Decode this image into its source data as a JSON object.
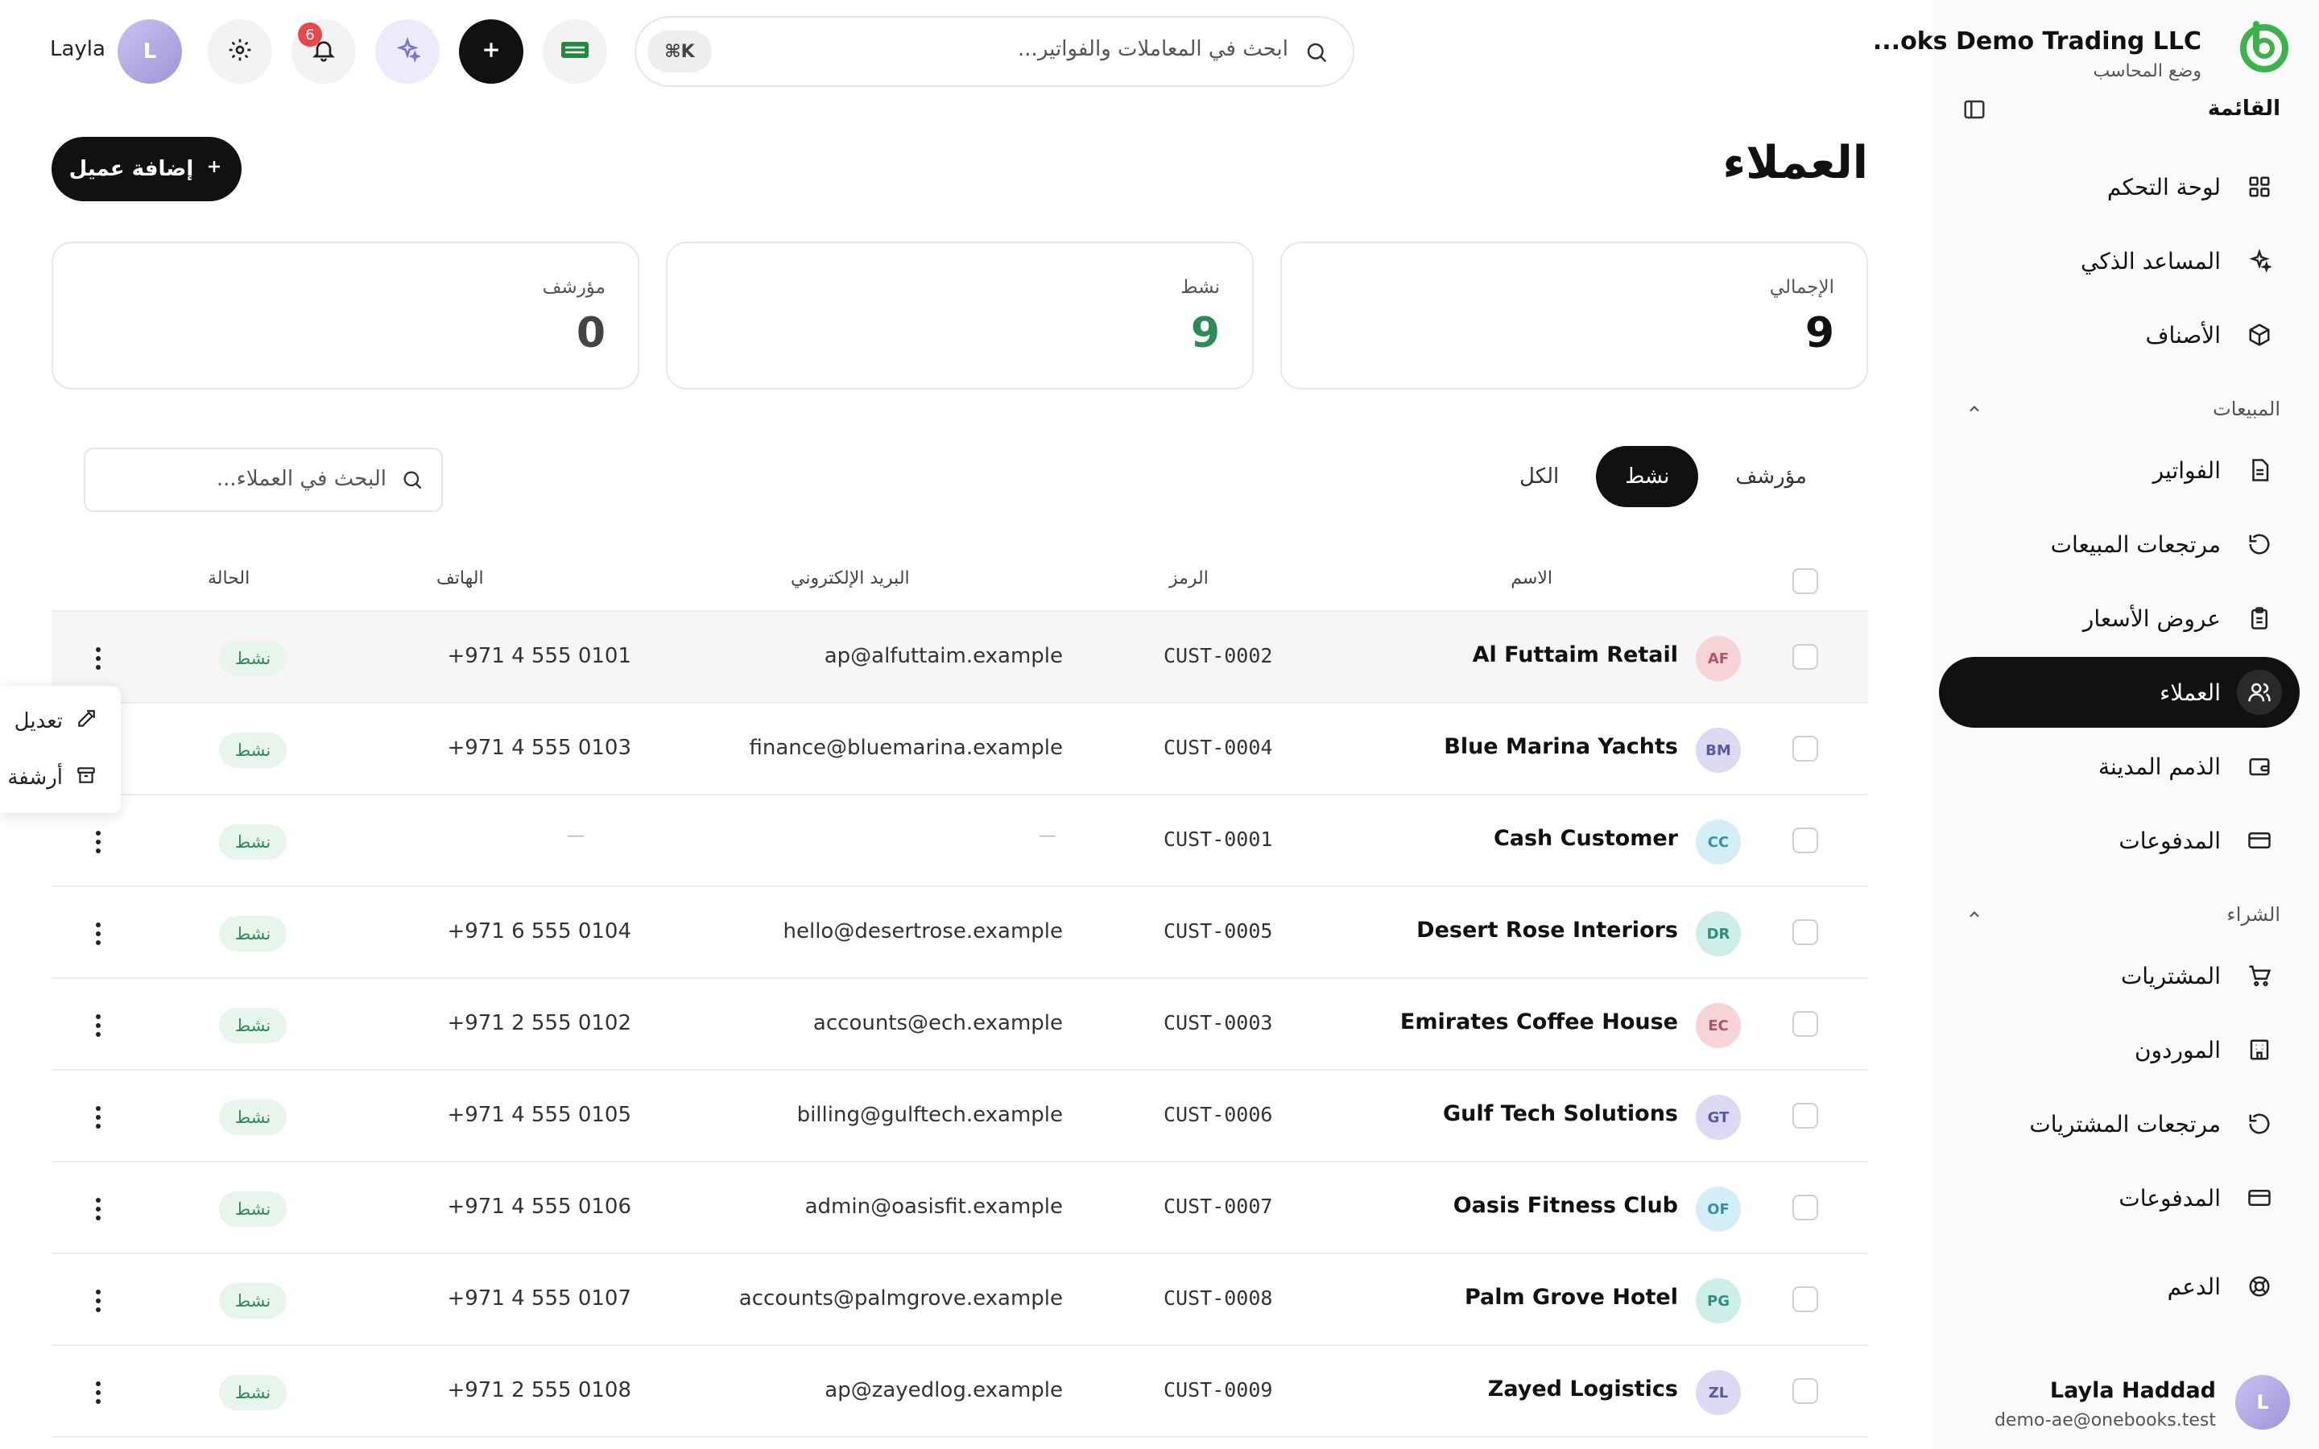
{
  "brand": {
    "name": "...oks Demo Trading LLC",
    "mode": "وضع المحاسب"
  },
  "sidebar": {
    "menu_title": "القائمة",
    "items_top": [
      {
        "label": "لوحة التحكم",
        "icon": "dashboard-icon"
      },
      {
        "label": "المساعد الذكي",
        "icon": "sparkles-icon"
      },
      {
        "label": "الأصناف",
        "icon": "box-icon"
      }
    ],
    "sales_title": "المبيعات",
    "sales_items": [
      {
        "label": "الفواتير",
        "icon": "document-icon"
      },
      {
        "label": "مرتجعات المبيعات",
        "icon": "undo-icon"
      },
      {
        "label": "عروض الأسعار",
        "icon": "clipboard-icon"
      },
      {
        "label": "العملاء",
        "icon": "users-icon",
        "active": true
      },
      {
        "label": "الذمم المدينة",
        "icon": "wallet-icon"
      },
      {
        "label": "المدفوعات",
        "icon": "card-icon"
      }
    ],
    "purchases_title": "الشراء",
    "purchase_items": [
      {
        "label": "المشتريات",
        "icon": "cart-icon"
      },
      {
        "label": "الموردون",
        "icon": "building-icon"
      },
      {
        "label": "مرتجعات المشتريات",
        "icon": "undo-icon"
      },
      {
        "label": "المدفوعات",
        "icon": "card-icon"
      }
    ],
    "support": {
      "label": "الدعم",
      "icon": "lifebuoy-icon"
    },
    "user": {
      "initial": "L",
      "name": "Layla Haddad",
      "email": "demo-ae@onebooks.test"
    }
  },
  "topbar": {
    "search_placeholder": "ابحث في المعاملات والفواتير...",
    "search_shortcut": "⌘K",
    "notification_count": "6",
    "avatar_initial": "L",
    "username": "Layla"
  },
  "page": {
    "title": "العملاء",
    "add_button": "إضافة عميل"
  },
  "stats": [
    {
      "label": "الإجمالي",
      "value": "9",
      "color": "#111111"
    },
    {
      "label": "نشط",
      "value": "9",
      "color": "#2e8b57"
    },
    {
      "label": "مؤرشف",
      "value": "0",
      "color": "#444444"
    }
  ],
  "tabs": {
    "all": "الكل",
    "active": "نشط",
    "archived": "مؤرشف",
    "selected": "active"
  },
  "table_search_placeholder": "البحث في العملاء...",
  "columns": {
    "name": "الاسم",
    "code": "الرمز",
    "email": "البريد الإلكتروني",
    "phone": "الهاتف",
    "status": "الحالة"
  },
  "rows": [
    {
      "initials": "AF",
      "avatar_bg": "#f6d3d6",
      "avatar_fg": "#b4555f",
      "name": "Al Futtaim Retail",
      "code": "CUST-0002",
      "email": "ap@alfuttaim.example",
      "phone": "+971 4 555 0101",
      "status": "نشط"
    },
    {
      "initials": "BM",
      "avatar_bg": "#dcdaf3",
      "avatar_fg": "#5b56a6",
      "name": "Blue Marina Yachts",
      "code": "CUST-0004",
      "email": "finance@bluemarina.example",
      "phone": "+971 4 555 0103",
      "status": "نشط"
    },
    {
      "initials": "CC",
      "avatar_bg": "#d4eef5",
      "avatar_fg": "#3a8fa8",
      "name": "Cash Customer",
      "code": "CUST-0001",
      "email": "—",
      "phone": "—",
      "status": "نشط"
    },
    {
      "initials": "DR",
      "avatar_bg": "#cdeee9",
      "avatar_fg": "#2f8c7f",
      "name": "Desert Rose Interiors",
      "code": "CUST-0005",
      "email": "hello@desertrose.example",
      "phone": "+971 6 555 0104",
      "status": "نشط"
    },
    {
      "initials": "EC",
      "avatar_bg": "#f6d3d6",
      "avatar_fg": "#b4555f",
      "name": "Emirates Coffee House",
      "code": "CUST-0003",
      "email": "accounts@ech.example",
      "phone": "+971 2 555 0102",
      "status": "نشط"
    },
    {
      "initials": "GT",
      "avatar_bg": "#dcdaf3",
      "avatar_fg": "#5b56a6",
      "name": "Gulf Tech Solutions",
      "code": "CUST-0006",
      "email": "billing@gulftech.example",
      "phone": "+971 4 555 0105",
      "status": "نشط"
    },
    {
      "initials": "OF",
      "avatar_bg": "#d4eef5",
      "avatar_fg": "#3a8fa8",
      "name": "Oasis Fitness Club",
      "code": "CUST-0007",
      "email": "admin@oasisfit.example",
      "phone": "+971 4 555 0106",
      "status": "نشط"
    },
    {
      "initials": "PG",
      "avatar_bg": "#cdeee9",
      "avatar_fg": "#2f8c7f",
      "name": "Palm Grove Hotel",
      "code": "CUST-0008",
      "email": "accounts@palmgrove.example",
      "phone": "+971 4 555 0107",
      "status": "نشط"
    },
    {
      "initials": "ZL",
      "avatar_bg": "#dcdaf3",
      "avatar_fg": "#5b56a6",
      "name": "Zayed Logistics",
      "code": "CUST-0009",
      "email": "ap@zayedlog.example",
      "phone": "+971 2 555 0108",
      "status": "نشط"
    }
  ],
  "context_menu": {
    "edit": "تعديل",
    "archive": "أرشفة"
  }
}
